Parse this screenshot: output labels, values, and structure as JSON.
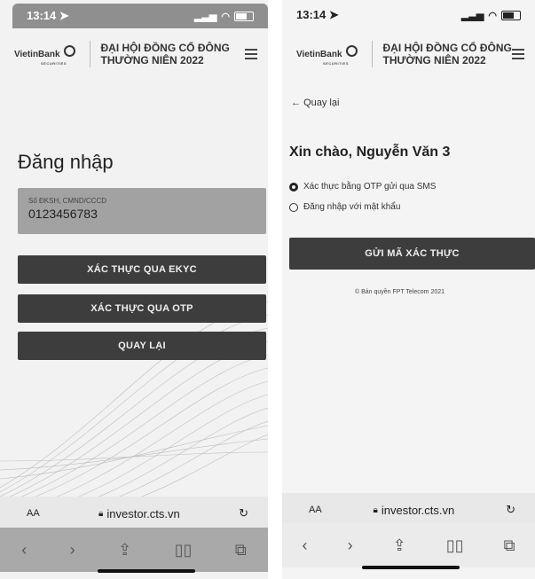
{
  "left": {
    "status": {
      "time": "13:14"
    },
    "header": {
      "logo_text": "VietinBank",
      "logo_sub": "SECURITIES",
      "title": "ĐẠI HỘI ĐỒNG CỔ ĐÔNG\nTHƯỜNG NIÊN 2022"
    },
    "page_title": "Đăng nhập",
    "id_field": {
      "label": "Số ĐKSH, CMND/CCCD",
      "value": "0123456783"
    },
    "buttons": {
      "ekyc": "XÁC THỰC QUA EKYC",
      "otp": "XÁC THỰC QUA OTP",
      "back": "QUAY LẠI"
    },
    "browser": {
      "aa": "AA",
      "url": "investor.cts.vn"
    }
  },
  "right": {
    "status": {
      "time": "13:14"
    },
    "header": {
      "logo_text": "VietinBank",
      "logo_sub": "SECURITIES",
      "title": "ĐẠI HỘI ĐỒNG CỔ ĐÔNG\nTHƯỜNG NIÊN 2022"
    },
    "back_link": "Quay lại",
    "greeting": "Xin chào, Nguyễn Văn 3",
    "options": {
      "otp": "Xác thực bằng OTP gửi qua SMS",
      "password": "Đăng nhập với mật khẩu"
    },
    "send_button": "GỬI MÃ XÁC THỰC",
    "copyright": "© Bản quyền FPT Telecom 2021",
    "browser": {
      "aa": "AA",
      "url": "investor.cts.vn"
    }
  },
  "icons": [
    "location-arrow-icon",
    "signal-icon",
    "wifi-icon",
    "battery-icon",
    "menu-icon",
    "lock-icon",
    "reload-icon",
    "back-icon",
    "forward-icon",
    "share-icon",
    "bookmarks-icon",
    "tabs-icon"
  ]
}
